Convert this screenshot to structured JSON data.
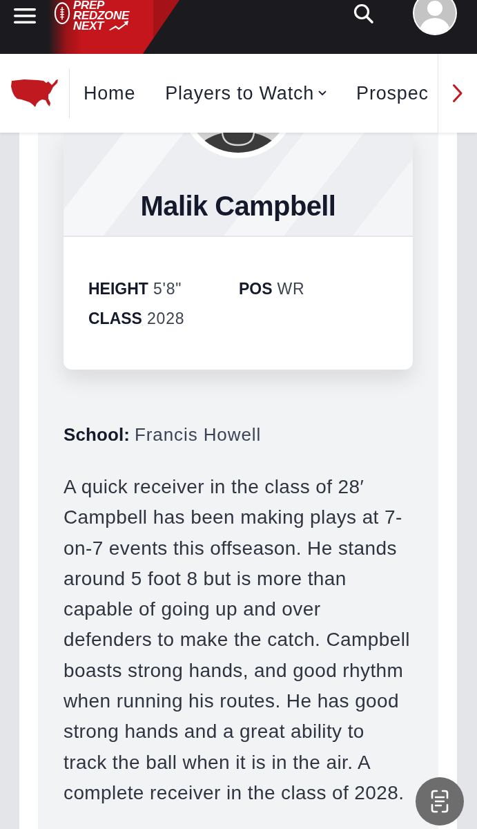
{
  "header": {
    "logo": {
      "lines": [
        "PREP",
        "REDZONE",
        "NEXT"
      ]
    }
  },
  "nav": {
    "items": [
      {
        "label": "Home",
        "has_dropdown": false
      },
      {
        "label": "Players to Watch",
        "has_dropdown": true
      },
      {
        "label": "Prospec",
        "has_dropdown": false
      }
    ]
  },
  "player": {
    "name": "Malik Campbell",
    "stats": [
      {
        "label": "HEIGHT",
        "value": "5'8\""
      },
      {
        "label": "POS",
        "value": "WR"
      },
      {
        "label": "CLASS",
        "value": "2028"
      }
    ]
  },
  "school": {
    "label": "School:",
    "value": "Francis Howell"
  },
  "bio": "A quick receiver in the class of 28′ Campbell has been making plays at 7-on-7 events this offseason. He stands around 5 foot 8 but is more than capable of going up and over defenders to make the catch. Campbell boasts strong hands, and good rhythm when running his routes. He has good strong hands and a great ability to track the ball when it is in the air. A complete receiver in the class of 2028."
}
